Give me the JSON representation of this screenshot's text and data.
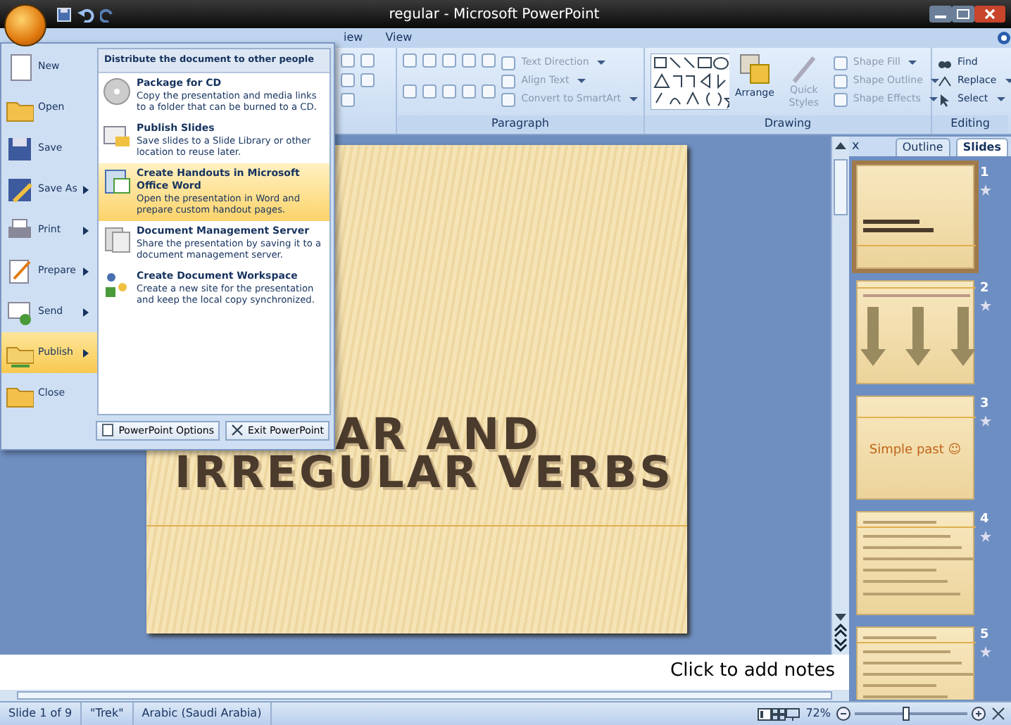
{
  "window": {
    "title": "regular - Microsoft PowerPoint"
  },
  "ribbon": {
    "tabs": [
      {
        "label": "iew",
        "selected": false
      },
      {
        "label": "View",
        "selected": false
      }
    ],
    "paragraph": {
      "label": "Paragraph",
      "commands": [
        {
          "label": "Text Direction",
          "disabled": true,
          "dropdown": true
        },
        {
          "label": "Align Text",
          "disabled": true,
          "dropdown": true
        },
        {
          "label": "Convert to SmartArt",
          "disabled": true,
          "dropdown": true
        }
      ]
    },
    "drawing": {
      "label": "Drawing",
      "arrange": "Arrange",
      "quick_styles": {
        "label": "Quick Styles",
        "disabled": true
      },
      "commands": [
        {
          "label": "Shape Fill",
          "disabled": true,
          "dropdown": true
        },
        {
          "label": "Shape Outline",
          "disabled": true,
          "dropdown": true
        },
        {
          "label": "Shape Effects",
          "disabled": true,
          "dropdown": true
        }
      ]
    },
    "editing": {
      "label": "Editing",
      "commands": [
        {
          "label": "Find",
          "dropdown": false
        },
        {
          "label": "Replace",
          "dropdown": true
        },
        {
          "label": "Select",
          "dropdown": true
        }
      ]
    }
  },
  "office_menu": {
    "items": [
      {
        "label": "New",
        "submenu": false,
        "selected": false
      },
      {
        "label": "Open",
        "submenu": false,
        "selected": false
      },
      {
        "label": "Save",
        "submenu": false,
        "selected": false
      },
      {
        "label": "Save As",
        "submenu": true,
        "selected": false
      },
      {
        "label": "Print",
        "submenu": true,
        "selected": false
      },
      {
        "label": "Prepare",
        "submenu": true,
        "selected": false
      },
      {
        "label": "Send",
        "submenu": true,
        "selected": false
      },
      {
        "label": "Publish",
        "submenu": true,
        "selected": true
      },
      {
        "label": "Close",
        "submenu": false,
        "selected": false
      }
    ],
    "panel": {
      "heading": "Distribute the document to other people",
      "entries": [
        {
          "title": "Package for CD",
          "description": "Copy the presentation and media links to a folder that can be burned to a CD.",
          "selected": false
        },
        {
          "title": "Publish Slides",
          "description": "Save slides to a Slide Library or other location to reuse later.",
          "selected": false
        },
        {
          "title": "Create Handouts in Microsoft Office Word",
          "description": "Open the presentation in Word and prepare custom handout pages.",
          "selected": true
        },
        {
          "title": "Document Management Server",
          "description": "Share the presentation by saving it to a document management server.",
          "selected": false
        },
        {
          "title": "Create Document Workspace",
          "description": "Create a new site for the presentation and keep the local copy synchronized.",
          "selected": false
        }
      ]
    },
    "buttons": [
      "PowerPoint Options",
      "Exit PowerPoint"
    ]
  },
  "slide": {
    "title_lines": [
      "AR AND",
      "IRREGULAR VERBS"
    ]
  },
  "slides_panel": {
    "close": "x",
    "tabs": [
      {
        "label": "Outline",
        "selected": false
      },
      {
        "label": "Slides",
        "selected": true
      }
    ],
    "thumbnails": [
      {
        "number": "1",
        "kind": "title",
        "selected": true
      },
      {
        "number": "2",
        "kind": "arrows",
        "selected": false
      },
      {
        "number": "3",
        "kind": "text",
        "text": "Simple past ☺",
        "selected": false
      },
      {
        "number": "4",
        "kind": "list",
        "selected": false
      },
      {
        "number": "5",
        "kind": "list",
        "selected": false
      }
    ]
  },
  "notes": {
    "placeholder": "Click to add notes"
  },
  "status_bar": {
    "slide": "Slide 1 of 9",
    "theme": "\"Trek\"",
    "language": "Arabic (Saudi Arabia)",
    "zoom": "72%",
    "zoom_slider": {
      "level": 0.45
    }
  }
}
